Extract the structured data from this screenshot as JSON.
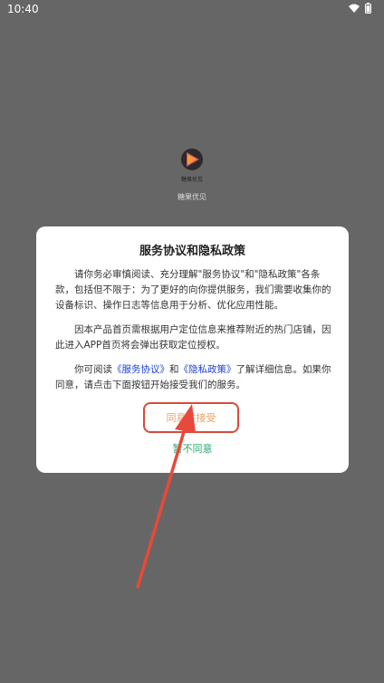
{
  "status_bar": {
    "time": "10:40"
  },
  "app": {
    "name": "糖果优见",
    "logo_text": "糖果优见"
  },
  "dialog": {
    "title": "服务协议和隐私政策",
    "paragraph1": "请你务必审慎阅读、充分理解\"服务协议\"和\"隐私政策\"各条款，包括但不限于：为了更好的向你提供服务，我们需要收集你的设备标识、操作日志等信息用于分析、优化应用性能。",
    "paragraph2": "因本产品首页需根据用户定位信息来推荐附近的热门店铺，因此进入APP首页将会弹出获取定位授权。",
    "paragraph3_prefix": "你可阅读",
    "service_link": "《服务协议》",
    "paragraph3_and": "和",
    "privacy_link": "《隐私政策》",
    "paragraph3_suffix": "了解详细信息。如果你同意，请点击下面按钮开始接受我们的服务。",
    "agree_label": "同意并接受",
    "decline_label": "暂不同意"
  },
  "colors": {
    "overlay": "#666666",
    "link": "#1a3fd8",
    "agree_text": "#e8a060",
    "highlight": "#d84a3a",
    "decline": "#2aa76a"
  }
}
